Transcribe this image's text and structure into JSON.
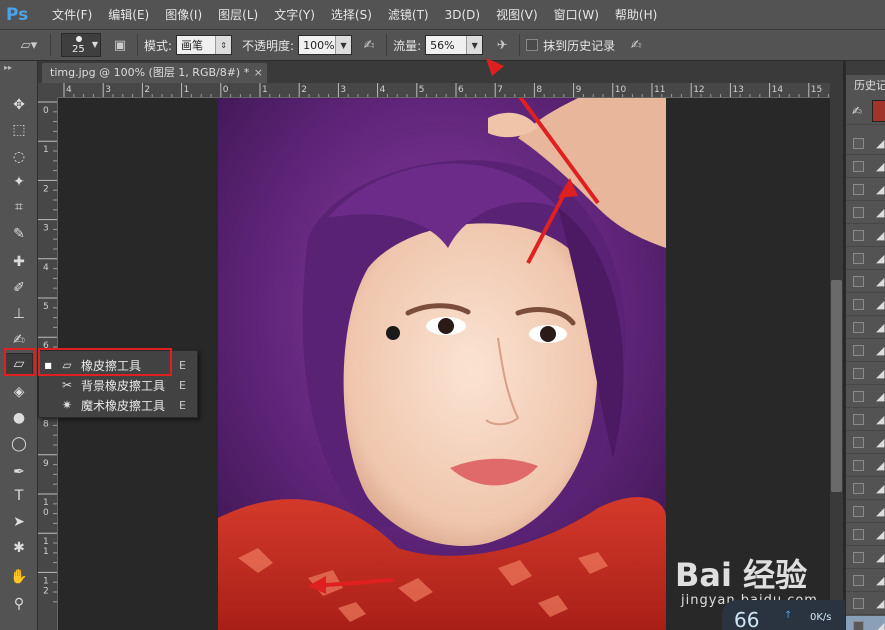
{
  "app": {
    "logo": "Ps",
    "accent_color": "#4aa3e8",
    "annotation_color": "#e02020"
  },
  "menu": [
    "文件(F)",
    "编辑(E)",
    "图像(I)",
    "图层(L)",
    "文字(Y)",
    "选择(S)",
    "滤镜(T)",
    "3D(D)",
    "视图(V)",
    "窗口(W)",
    "帮助(H)"
  ],
  "options": {
    "brush_size": "25",
    "mode_label": "模式:",
    "mode_value": "画笔",
    "opacity_label": "不透明度:",
    "opacity_value": "100%",
    "flow_label": "流量:",
    "flow_value": "56%",
    "history_label": "抹到历史记录"
  },
  "document": {
    "tab_title": "timg.jpg @ 100% (图层 1, RGB/8#) *",
    "close_glyph": "×"
  },
  "rulers": {
    "horizontal": [
      "4",
      "3",
      "2",
      "1",
      "0",
      "1",
      "2",
      "3",
      "4",
      "5",
      "6",
      "7",
      "8",
      "9",
      "10",
      "11",
      "12",
      "13",
      "14",
      "15"
    ],
    "vertical": [
      "0",
      "1",
      "2",
      "3",
      "4",
      "5",
      "6",
      "7",
      "8",
      "9",
      "1\n0",
      "1\n1",
      "1\n2"
    ]
  },
  "tools": [
    {
      "name": "move-tool-icon",
      "glyph": "✥"
    },
    {
      "name": "marquee-tool-icon",
      "glyph": "⬚"
    },
    {
      "name": "lasso-tool-icon",
      "glyph": "◌"
    },
    {
      "name": "magic-wand-tool-icon",
      "glyph": "✦"
    },
    {
      "name": "crop-tool-icon",
      "glyph": "⌗"
    },
    {
      "name": "eyedropper-tool-icon",
      "glyph": "✎"
    },
    {
      "name": "healing-brush-tool-icon",
      "glyph": "✚"
    },
    {
      "name": "brush-tool-icon",
      "glyph": "✐"
    },
    {
      "name": "stamp-tool-icon",
      "glyph": "⊥"
    },
    {
      "name": "history-brush-tool-icon",
      "glyph": "✍"
    },
    {
      "name": "eraser-tool-icon",
      "glyph": "▱"
    },
    {
      "name": "paint-bucket-tool-icon",
      "glyph": "◈"
    },
    {
      "name": "blur-tool-icon",
      "glyph": "●"
    },
    {
      "name": "dodge-tool-icon",
      "glyph": "◯"
    },
    {
      "name": "pen-tool-icon",
      "glyph": "✒"
    },
    {
      "name": "type-tool-icon",
      "glyph": "T"
    },
    {
      "name": "path-selection-tool-icon",
      "glyph": "➤"
    },
    {
      "name": "shape-tool-icon",
      "glyph": "✱"
    },
    {
      "name": "hand-tool-icon",
      "glyph": "✋"
    },
    {
      "name": "zoom-tool-icon",
      "glyph": "⚲"
    }
  ],
  "flyout": {
    "items": [
      {
        "label": "橡皮擦工具",
        "shortcut": "E",
        "selected": true
      },
      {
        "label": "背景橡皮擦工具",
        "shortcut": "E",
        "selected": false
      },
      {
        "label": "魔术橡皮擦工具",
        "shortcut": "E",
        "selected": false
      }
    ]
  },
  "history_panel": {
    "title": "历史记",
    "rows": 22
  },
  "watermark": {
    "main": "Bai 经验",
    "sub": "jingyan.baidu.com",
    "speed": "66",
    "rate": "0K/s"
  }
}
